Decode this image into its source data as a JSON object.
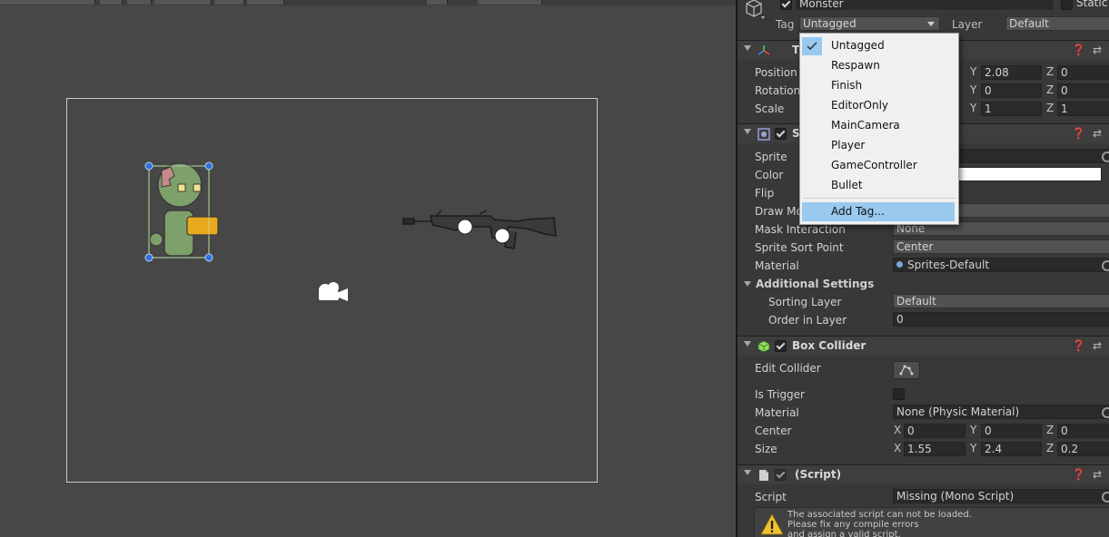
{
  "header": {
    "object_name": "Monster",
    "static_label": "Static",
    "tag_label": "Tag",
    "tag_value": "Untagged",
    "layer_label": "Layer",
    "layer_value": "Default"
  },
  "tag_dropdown": {
    "items": [
      "Untagged",
      "Respawn",
      "Finish",
      "EditorOnly",
      "MainCamera",
      "Player",
      "GameController",
      "Bullet"
    ],
    "selected": "Untagged",
    "add_tag": "Add Tag..."
  },
  "transform": {
    "title": "T",
    "position_label": "Position",
    "rotation_label": "Rotation",
    "scale_label": "Scale",
    "position": {
      "y": "2.08",
      "z": "0"
    },
    "rotation": {
      "y": "0",
      "z": "0"
    },
    "scale": {
      "y": "1",
      "z": "1"
    }
  },
  "sprite_renderer": {
    "title": "S",
    "sprite_label": "Sprite",
    "color_label": "Color",
    "flip_label": "Flip",
    "draw_mode_label": "Draw Mo",
    "mask_label": "Mask Interaction",
    "mask_value": "None",
    "sort_point_label": "Sprite Sort Point",
    "sort_point_value": "Center",
    "material_label": "Material",
    "material_value": "Sprites-Default",
    "additional_label": "Additional Settings",
    "sorting_layer_label": "Sorting Layer",
    "sorting_layer_value": "Default",
    "order_label": "Order in Layer",
    "order_value": "0"
  },
  "box_collider": {
    "title": "Box Collider",
    "edit_label": "Edit Collider",
    "trigger_label": "Is Trigger",
    "material_label": "Material",
    "material_value": "None (Physic Material)",
    "center_label": "Center",
    "center": {
      "x": "0",
      "y": "0",
      "z": "0"
    },
    "size_label": "Size",
    "size": {
      "x": "1.55",
      "y": "2.4",
      "z": "0.2"
    }
  },
  "script": {
    "title": "(Script)",
    "script_label": "Script",
    "script_value": "Missing (Mono Script)",
    "warning_lines": [
      "The associated script can not be loaded.",
      "Please fix any compile errors",
      "and assign a valid script."
    ]
  },
  "axes": {
    "x": "X",
    "y": "Y",
    "z": "Z"
  },
  "icons": {
    "header": [
      "cube-icon",
      "transform-icon",
      "sprite-renderer-icon",
      "box-collider-icon",
      "script-icon",
      "warning-icon",
      "help-icon",
      "settings-icon",
      "camera-gizmo-icon",
      "edit-collider-icon"
    ]
  },
  "colors": {
    "inspector_bg": "#383838",
    "scene_bg": "#474747",
    "highlight": "#99c9ef",
    "collider_green": "#8ce05a"
  }
}
